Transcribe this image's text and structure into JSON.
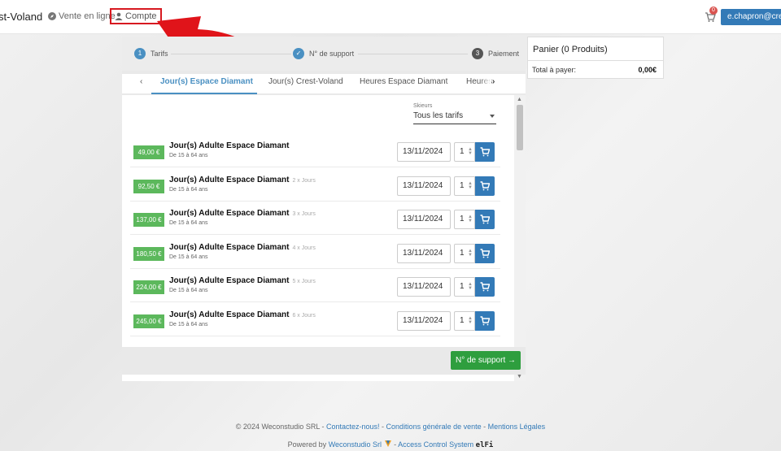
{
  "header": {
    "brand": "st-Voland",
    "nav_online": "Vente en ligne",
    "nav_account": "Compte",
    "cart_count": "0",
    "user_email": "e.chapron@crest"
  },
  "steps": [
    {
      "num": "1",
      "label": "Tarifs"
    },
    {
      "num": "✓",
      "label": "N° de support"
    },
    {
      "num": "3",
      "label": "Paiement"
    }
  ],
  "tabs": {
    "prev": "‹",
    "next": "›",
    "items": [
      "Jour(s) Espace Diamant",
      "Jour(s) Crest-Voland",
      "Heures Espace Diamant",
      "Heures"
    ]
  },
  "filter": {
    "label": "Skieurs",
    "value": "Tous les tarifs"
  },
  "products": [
    {
      "price": "49,00 €",
      "title": "Jour(s) Adulte Espace Diamant",
      "days": "",
      "subtitle": "De 15 à 64 ans",
      "date": "13/11/2024",
      "qty": "1"
    },
    {
      "price": "92,50 €",
      "title": "Jour(s) Adulte Espace Diamant",
      "days": "2 x Jours",
      "subtitle": "De 15 à 64 ans",
      "date": "13/11/2024",
      "qty": "1"
    },
    {
      "price": "137,00 €",
      "title": "Jour(s) Adulte Espace Diamant",
      "days": "3 x Jours",
      "subtitle": "De 15 à 64 ans",
      "date": "13/11/2024",
      "qty": "1"
    },
    {
      "price": "180,50 €",
      "title": "Jour(s) Adulte Espace Diamant",
      "days": "4 x Jours",
      "subtitle": "De 15 à 64 ans",
      "date": "13/11/2024",
      "qty": "1"
    },
    {
      "price": "224,00 €",
      "title": "Jour(s) Adulte Espace Diamant",
      "days": "5 x Jours",
      "subtitle": "De 15 à 64 ans",
      "date": "13/11/2024",
      "qty": "1"
    },
    {
      "price": "245,00 €",
      "title": "Jour(s) Adulte Espace Diamant",
      "days": "6 x Jours",
      "subtitle": "De 15 à 64 ans",
      "date": "13/11/2024",
      "qty": "1"
    }
  ],
  "next_button": "N° de support →",
  "cart": {
    "title": "Panier (0 Produits)",
    "total_label": "Total à payer:",
    "total_value": "0,00€"
  },
  "footer": {
    "copyright": "© 2024 Weconstudio SRL - ",
    "contact": "Contactez-nous!",
    "sep1": " - ",
    "cgv": "Conditions générale de vente",
    "sep2": " - ",
    "legal": "Mentions Légales",
    "powered_prefix": "Powered by ",
    "powered_link": "Weconstudio Srl",
    "access_link": "Access Control System",
    "sep3": " - ",
    "elfi": "elFi"
  },
  "colors": {
    "accent_blue": "#337ab7",
    "tab_blue": "#4a90c2",
    "price_green": "#5cb85c",
    "next_green": "#2e9e3e",
    "highlight_red": "#d71920"
  }
}
